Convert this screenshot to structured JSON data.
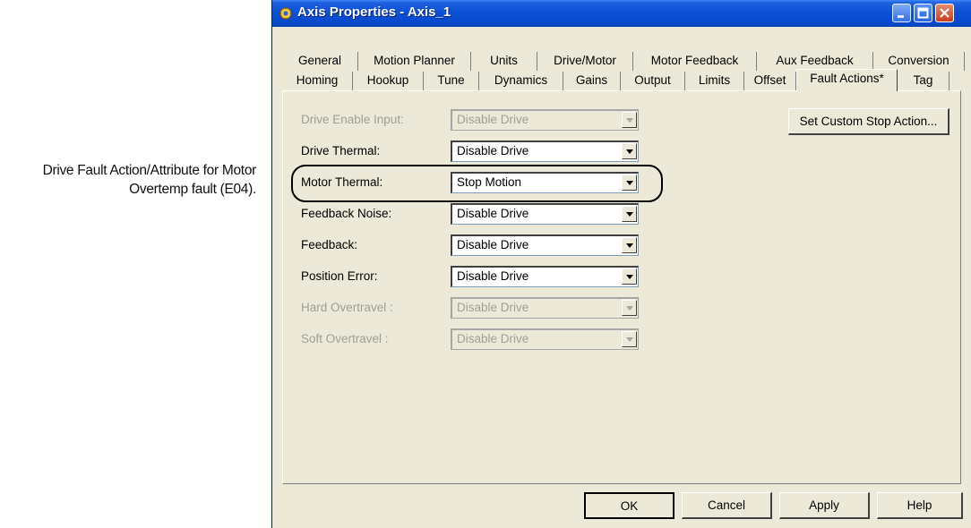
{
  "callout": {
    "line1": "Drive Fault Action/Attribute for Motor",
    "line2": "Overtemp fault (E04)."
  },
  "window": {
    "title": "Axis Properties - Axis_1",
    "icon": "axis-properties-icon",
    "controls": {
      "minimize": "minimize-icon",
      "maximize": "maximize-icon",
      "close": "close-icon"
    }
  },
  "tabs_row1": [
    "General",
    "Motion Planner",
    "Units",
    "Drive/Motor",
    "Motor Feedback",
    "Aux Feedback",
    "Conversion"
  ],
  "tabs_row2": [
    "Homing",
    "Hookup",
    "Tune",
    "Dynamics",
    "Gains",
    "Output",
    "Limits",
    "Offset",
    "Fault Actions*",
    "Tag"
  ],
  "selected_tab": "Fault Actions*",
  "fault_rows": [
    {
      "label": "Drive Enable Input:",
      "value": "Disable Drive",
      "enabled": false
    },
    {
      "label": "Drive Thermal:",
      "value": "Disable Drive",
      "enabled": true
    },
    {
      "label": "Motor Thermal:",
      "value": "Stop Motion",
      "enabled": true
    },
    {
      "label": "Feedback Noise:",
      "value": "Disable Drive",
      "enabled": true
    },
    {
      "label": "Feedback:",
      "value": "Disable Drive",
      "enabled": true
    },
    {
      "label": "Position Error:",
      "value": "Disable Drive",
      "enabled": true
    },
    {
      "label": "Hard Overtravel :",
      "value": "Disable Drive",
      "enabled": false
    },
    {
      "label": "Soft Overtravel :",
      "value": "Disable Drive",
      "enabled": false
    }
  ],
  "custom_stop_button": "Set Custom Stop Action...",
  "buttons": {
    "ok": "OK",
    "cancel": "Cancel",
    "apply": "Apply",
    "help": "Help"
  },
  "colors": {
    "titlebar": "#0a4fd6",
    "dialog_bg": "#ece9d8",
    "disabled_text": "#a09f97"
  }
}
